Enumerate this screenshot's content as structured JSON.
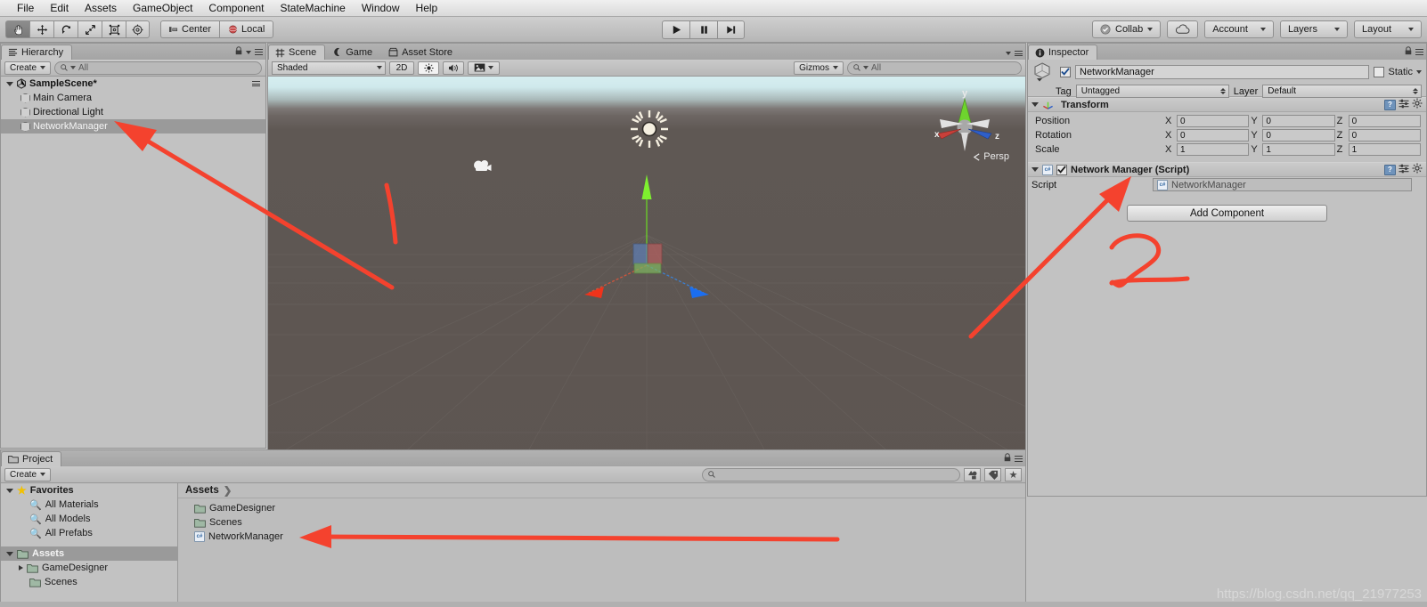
{
  "menubar": {
    "items": [
      "File",
      "Edit",
      "Assets",
      "GameObject",
      "Component",
      "StateMachine",
      "Window",
      "Help"
    ]
  },
  "toolbar": {
    "tools": [
      {
        "name": "hand-tool",
        "glyph": "✋",
        "active": true
      },
      {
        "name": "move-tool",
        "glyph": "✥",
        "active": false
      },
      {
        "name": "rotate-tool",
        "glyph": "⟳",
        "active": false
      },
      {
        "name": "scale-tool",
        "glyph": "⤢",
        "active": false
      },
      {
        "name": "rect-tool",
        "glyph": "▣",
        "active": false
      },
      {
        "name": "transform-tool",
        "glyph": "◎",
        "active": false
      }
    ],
    "pivot_label": "Center",
    "handle_label": "Local",
    "play_label": "▶",
    "pause_label": "❚❚",
    "step_label": "▶❙",
    "collab_label": "Collab",
    "cloud_label": "",
    "account_label": "Account",
    "layers_label": "Layers",
    "layout_label": "Layout"
  },
  "hierarchy": {
    "tab_label": "Hierarchy",
    "create_label": "Create",
    "search_placeholder": "All",
    "scene_name": "SampleScene*",
    "objects": [
      {
        "label": "Main Camera",
        "selected": false
      },
      {
        "label": "Directional Light",
        "selected": false
      },
      {
        "label": "NetworkManager",
        "selected": true
      }
    ]
  },
  "sceneview": {
    "tabs": [
      {
        "label": "Scene",
        "icon": "grid-icon",
        "active": true
      },
      {
        "label": "Game",
        "icon": "gamepad-icon",
        "active": false
      },
      {
        "label": "Asset Store",
        "icon": "store-icon",
        "active": false
      }
    ],
    "shading_mode": "Shaded",
    "twod_label": "2D",
    "gizmos_label": "Gizmos",
    "search_placeholder": "All",
    "projection_label": "Persp",
    "axis_labels": {
      "x": "x",
      "y": "y",
      "z": "z"
    }
  },
  "inspector": {
    "tab_label": "Inspector",
    "object_name": "NetworkManager",
    "object_enabled": true,
    "static_label": "Static",
    "tag_label": "Tag",
    "tag_value": "Untagged",
    "layer_label": "Layer",
    "layer_value": "Default",
    "transform": {
      "title": "Transform",
      "rows": [
        {
          "label": "Position",
          "x": "0",
          "y": "0",
          "z": "0"
        },
        {
          "label": "Rotation",
          "x": "0",
          "y": "0",
          "z": "0"
        },
        {
          "label": "Scale",
          "x": "1",
          "y": "1",
          "z": "1"
        }
      ],
      "axes": [
        "X",
        "Y",
        "Z"
      ]
    },
    "script_component": {
      "title": "Network Manager (Script)",
      "enabled": true,
      "script_label": "Script",
      "script_value": "NetworkManager"
    },
    "add_component_label": "Add Component"
  },
  "project": {
    "tab_label": "Project",
    "create_label": "Create",
    "search_placeholder": "",
    "breadcrumb": "Assets",
    "tree": [
      {
        "label": "Favorites",
        "type": "favorites",
        "depth": 0,
        "expanded": true,
        "bold": true
      },
      {
        "label": "All Materials",
        "type": "search",
        "depth": 1,
        "bold": false
      },
      {
        "label": "All Models",
        "type": "search",
        "depth": 1,
        "bold": false
      },
      {
        "label": "All Prefabs",
        "type": "search",
        "depth": 1,
        "bold": false
      },
      {
        "label": "Assets",
        "type": "folder",
        "depth": 0,
        "expanded": true,
        "bold": true,
        "selected": true
      },
      {
        "label": "GameDesigner",
        "type": "folder",
        "depth": 1,
        "expanded": false,
        "bold": false
      },
      {
        "label": "Scenes",
        "type": "folder",
        "depth": 1,
        "bold": false
      }
    ],
    "contents": [
      {
        "label": "GameDesigner",
        "type": "folder"
      },
      {
        "label": "Scenes",
        "type": "folder"
      },
      {
        "label": "NetworkManager",
        "type": "csharp"
      }
    ]
  },
  "annotations": {
    "marker_one": "1",
    "marker_two": "2",
    "color": "#f4422e"
  },
  "watermark": "https://blog.csdn.net/qq_21977253"
}
